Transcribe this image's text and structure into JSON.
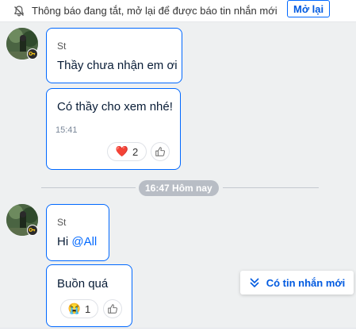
{
  "notice": {
    "text": "Thông báo đang tắt, mở lại để được báo tin nhắn mới",
    "button_label": "Mở lại"
  },
  "messages": {
    "group1": {
      "sender": "St",
      "text1": "Thầy chưa nhận em ơi",
      "text2": "Có thầy cho xem nhé!",
      "time": "15:41",
      "reaction_emoji": "❤️",
      "reaction_count": "2"
    },
    "divider_label": "16:47 Hôm nay",
    "group2": {
      "sender": "St",
      "text_prefix": "Hi ",
      "mention": "@All",
      "text2": "Buồn quá",
      "reaction_emoji": "😭",
      "reaction_count": "1"
    }
  },
  "new_messages_label": "Có tin nhắn mới",
  "icons": {
    "bell": "bell-off-icon",
    "like": "thumbs-up-icon",
    "new_messages": "double-chevron-down-icon"
  }
}
